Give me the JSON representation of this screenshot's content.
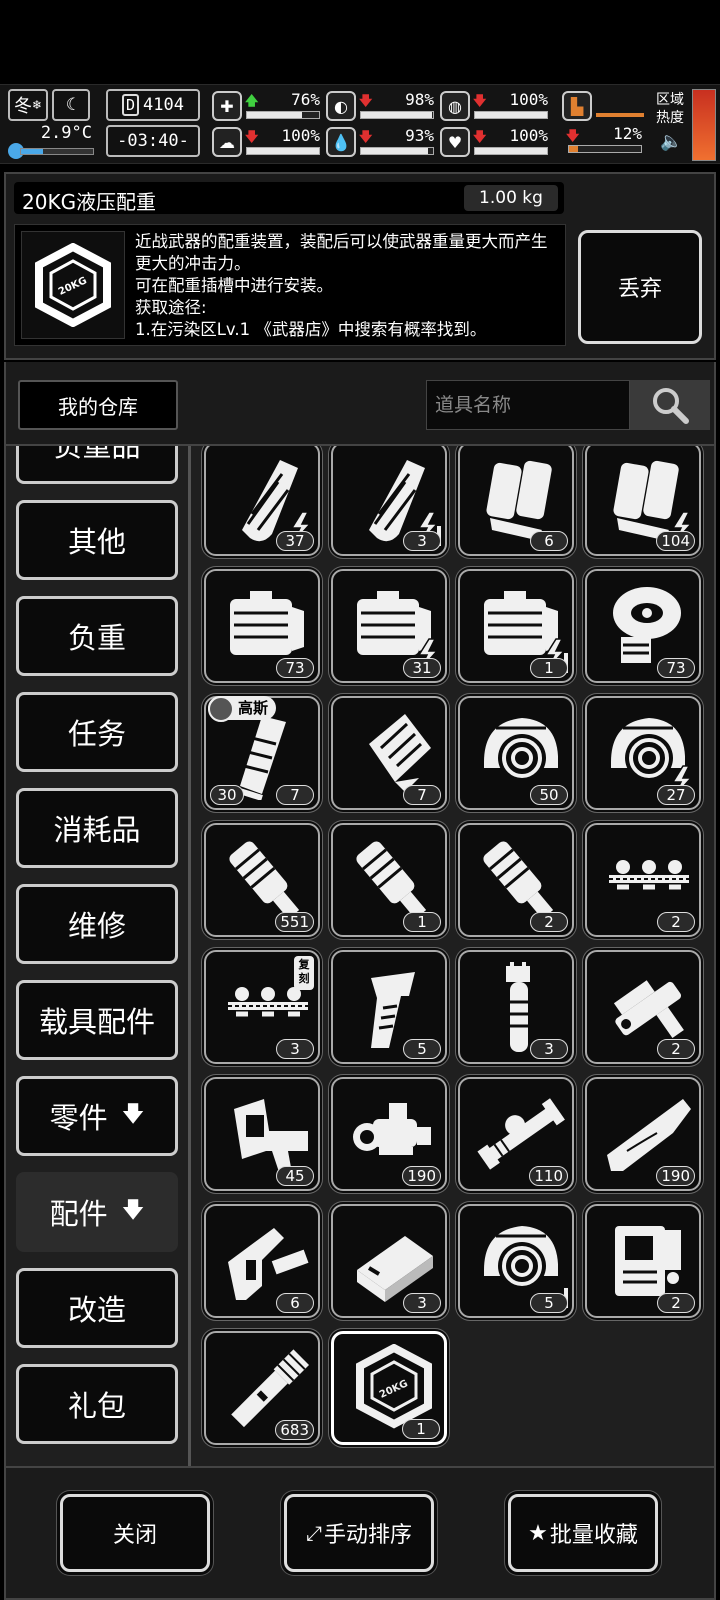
{
  "status": {
    "season": "冬",
    "temperature": "2.9°C",
    "day": "4104",
    "time": "-03:40-",
    "stats": [
      {
        "key": "health",
        "arrow": "up",
        "value": "76%",
        "level": 0.76
      },
      {
        "key": "hunger",
        "arrow": "down",
        "value": "98%",
        "level": 0.98
      },
      {
        "key": "energy",
        "arrow": "down",
        "value": "100%",
        "level": 1.0
      },
      {
        "key": "stamina",
        "arrow": "down",
        "value": "100%",
        "level": 1.0
      },
      {
        "key": "thirst",
        "arrow": "down",
        "value": "93%",
        "level": 0.93
      },
      {
        "key": "mood",
        "arrow": "down",
        "value": "100%",
        "level": 1.0
      }
    ],
    "load_value": "12%",
    "region_heat_label_1": "区域",
    "region_heat_label_2": "热度"
  },
  "item": {
    "name": "20KG液压配重",
    "weight": "1.00 kg",
    "icon_text": "20KG",
    "description": "近战武器的配重装置，装配后可以使武器重量更大而产生更大的冲击力。\n可在配重插槽中进行安装。\n获取途径:\n1.在污染区Lv.1 《武器店》中搜索有概率找到。",
    "discard_label": "丢弃"
  },
  "warehouse": {
    "title": "我的仓库",
    "search_placeholder": "道具名称"
  },
  "categories": [
    {
      "label": "负重品"
    },
    {
      "label": "其他"
    },
    {
      "label": "负重"
    },
    {
      "label": "任务"
    },
    {
      "label": "消耗品"
    },
    {
      "label": "维修"
    },
    {
      "label": "载具配件"
    },
    {
      "label": "零件",
      "arrow": "🡇"
    },
    {
      "label": "配件",
      "arrow": "🡇",
      "active": true
    },
    {
      "label": "改造"
    },
    {
      "label": "礼包"
    }
  ],
  "items": [
    {
      "icon": "magazine-curved-icon",
      "count": "37",
      "mod": "bolt"
    },
    {
      "icon": "magazine-curved-icon",
      "count": "3",
      "mod": "bolt-plus"
    },
    {
      "icon": "magazine-double-icon",
      "count": "6"
    },
    {
      "icon": "magazine-double-icon",
      "count": "104",
      "mod": "bolt"
    },
    {
      "icon": "ammo-box-icon",
      "count": "73"
    },
    {
      "icon": "ammo-box-icon",
      "count": "31",
      "mod": "bolt"
    },
    {
      "icon": "ammo-box-icon",
      "count": "1",
      "mod": "bolt-plus"
    },
    {
      "icon": "drum-magazine-icon",
      "count": "73"
    },
    {
      "icon": "magazine-straight-icon",
      "count": "7",
      "count2": "30",
      "tag": "高斯"
    },
    {
      "icon": "magazine-box-icon",
      "count": "7"
    },
    {
      "icon": "drum-helmet-icon",
      "count": "50"
    },
    {
      "icon": "drum-helmet-icon",
      "count": "27",
      "mod": "bolt"
    },
    {
      "icon": "suppressor-icon",
      "count": "551"
    },
    {
      "icon": "suppressor-icon",
      "count": "1"
    },
    {
      "icon": "suppressor-icon",
      "count": "2"
    },
    {
      "icon": "rail-mount-icon",
      "count": "2"
    },
    {
      "icon": "rail-mount-icon",
      "count": "3",
      "tag2": "复刻"
    },
    {
      "icon": "grip-icon",
      "count": "5"
    },
    {
      "icon": "vertical-grip-icon",
      "count": "3"
    },
    {
      "icon": "launcher-icon",
      "count": "2"
    },
    {
      "icon": "sight-mount-icon",
      "count": "45"
    },
    {
      "icon": "red-dot-scope-icon",
      "count": "190"
    },
    {
      "icon": "rifle-scope-icon",
      "count": "110"
    },
    {
      "icon": "wood-stock-icon",
      "count": "190"
    },
    {
      "icon": "rifle-stock-icon",
      "count": "6"
    },
    {
      "icon": "battery-pack-icon",
      "count": "3"
    },
    {
      "icon": "drum-helmet-icon",
      "count": "5",
      "mod": "plus"
    },
    {
      "icon": "receiver-icon",
      "count": "2"
    },
    {
      "icon": "flashlight-icon",
      "count": "683"
    },
    {
      "icon": "weight-20kg-icon",
      "count": "1",
      "selected": true,
      "icon_text": "20KG"
    }
  ],
  "buttons": {
    "close": "关闭",
    "manual_sort": "手动排序",
    "batch_favorite": "批量收藏"
  }
}
